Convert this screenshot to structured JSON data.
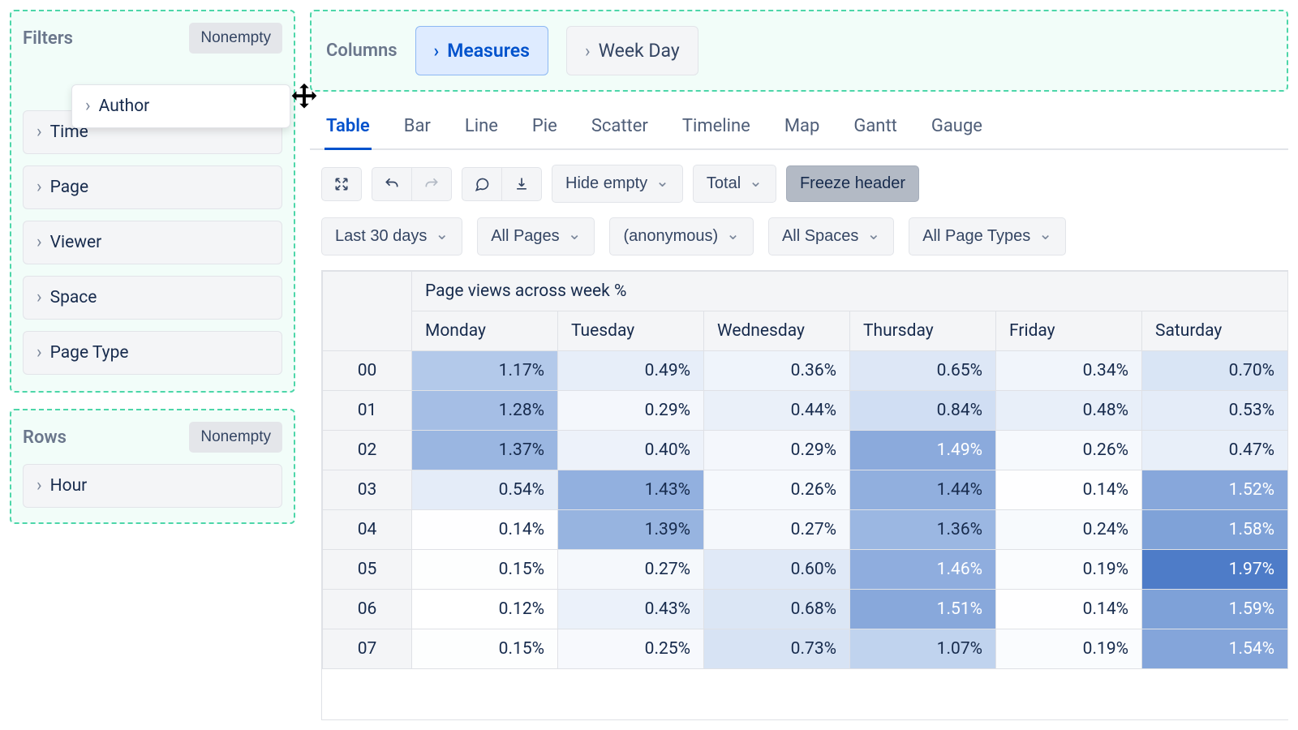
{
  "filters": {
    "title": "Filters",
    "nonempty_label": "Nonempty",
    "dragging_label": "Author",
    "items": [
      "Time",
      "Page",
      "Viewer",
      "Space",
      "Page Type"
    ]
  },
  "rows": {
    "title": "Rows",
    "nonempty_label": "Nonempty",
    "items": [
      "Hour"
    ]
  },
  "columns": {
    "title": "Columns",
    "items": [
      {
        "label": "Measures",
        "active": true
      },
      {
        "label": "Week Day",
        "active": false
      }
    ]
  },
  "chart_tabs": [
    "Table",
    "Bar",
    "Line",
    "Pie",
    "Scatter",
    "Timeline",
    "Map",
    "Gantt",
    "Gauge"
  ],
  "active_chart_tab": "Table",
  "toolbar": {
    "hide_empty": "Hide empty",
    "total": "Total",
    "freeze_header": "Freeze header"
  },
  "quick_filters": [
    "Last 30 days",
    "All Pages",
    "(anonymous)",
    "All Spaces",
    "All Page Types"
  ],
  "chart_data": {
    "type": "heatmap",
    "title": "Page views across week %",
    "xlabel": "Week Day",
    "ylabel": "Hour",
    "x": [
      "Monday",
      "Tuesday",
      "Wednesday",
      "Thursday",
      "Friday",
      "Saturday"
    ],
    "y": [
      "00",
      "01",
      "02",
      "03",
      "04",
      "05",
      "06",
      "07"
    ],
    "values": [
      [
        1.17,
        0.49,
        0.36,
        0.65,
        0.34,
        0.7
      ],
      [
        1.28,
        0.29,
        0.44,
        0.84,
        0.48,
        0.53
      ],
      [
        1.37,
        0.4,
        0.29,
        1.49,
        0.26,
        0.47
      ],
      [
        0.54,
        1.43,
        0.26,
        1.44,
        0.14,
        1.52
      ],
      [
        0.14,
        1.39,
        0.27,
        1.36,
        0.24,
        1.58
      ],
      [
        0.15,
        0.27,
        0.6,
        1.46,
        0.19,
        1.97
      ],
      [
        0.12,
        0.43,
        0.68,
        1.51,
        0.14,
        1.59
      ],
      [
        0.15,
        0.25,
        0.73,
        1.07,
        0.19,
        1.54
      ]
    ],
    "unit": "%",
    "value_range": [
      0.12,
      1.97
    ]
  }
}
